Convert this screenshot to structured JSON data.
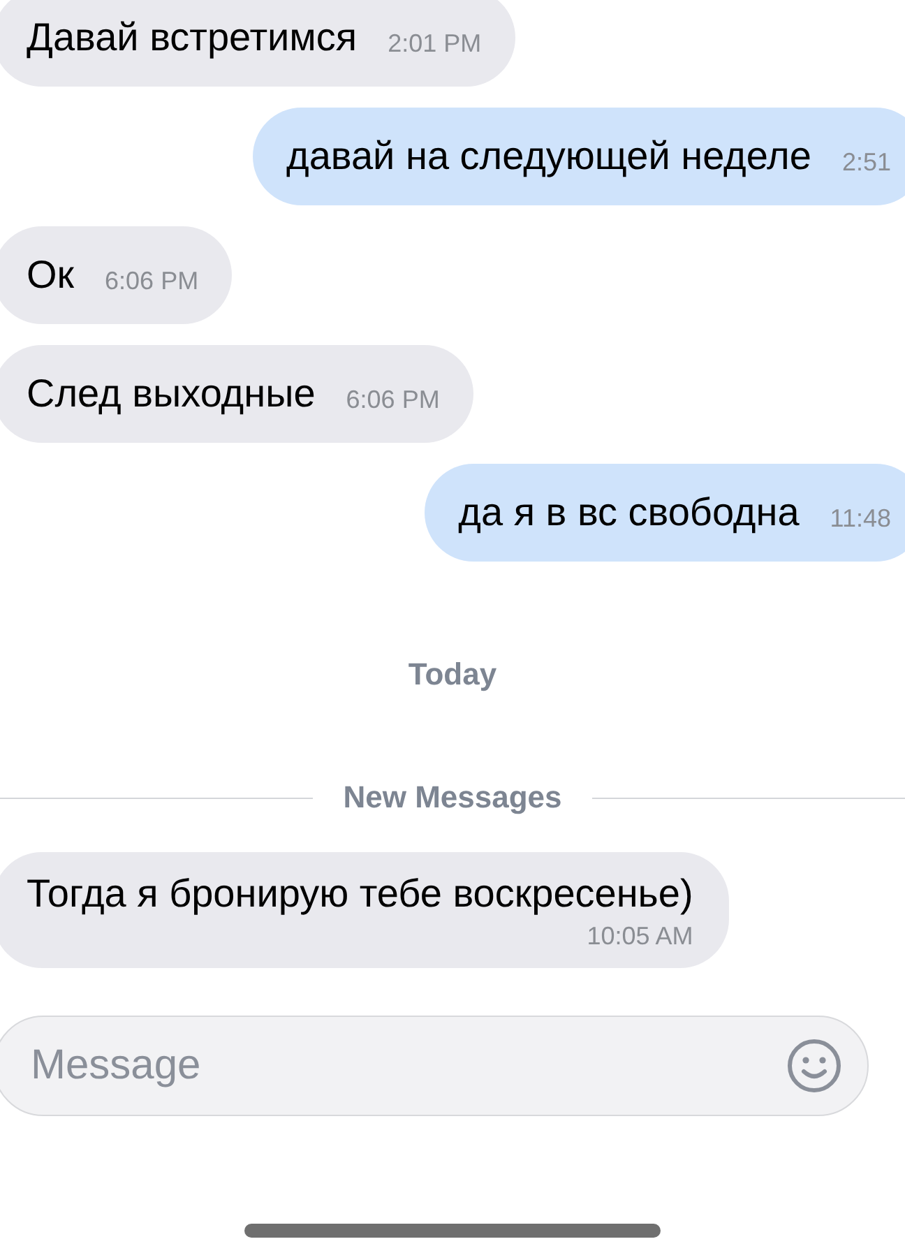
{
  "messages": [
    {
      "outgoing": false,
      "text": "Давай встретимся",
      "time": "2:01 PM",
      "time_below": false
    },
    {
      "outgoing": true,
      "text": "давай на следующей неделе",
      "time": "2:51",
      "time_below": false
    },
    {
      "outgoing": false,
      "text": "Ок",
      "time": "6:06 PM",
      "time_below": false
    },
    {
      "outgoing": false,
      "text": "След выходные",
      "time": "6:06 PM",
      "time_below": false
    },
    {
      "outgoing": true,
      "text": "да я в вс свободна",
      "time": "11:48",
      "time_below": false
    }
  ],
  "day_separator": "Today",
  "new_messages_divider": "New Messages",
  "new_messages": [
    {
      "outgoing": false,
      "text": "Тогда я бронирую тебе воскресенье)",
      "time": "10:05 AM",
      "time_below": true
    }
  ],
  "composer": {
    "placeholder": "Message"
  }
}
